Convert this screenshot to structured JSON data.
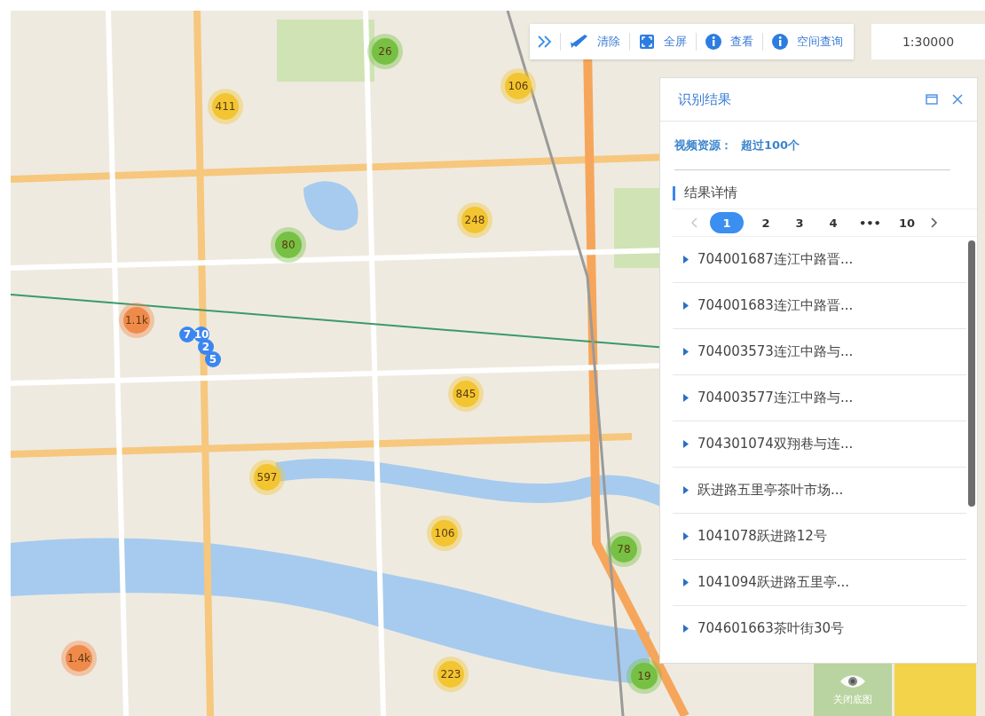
{
  "toolbar": {
    "items": [
      {
        "kind": "clear",
        "label": "清除"
      },
      {
        "kind": "fullscreen",
        "label": "全屏"
      },
      {
        "kind": "info",
        "label": "查看"
      },
      {
        "kind": "info",
        "label": "空间查询"
      }
    ],
    "scale": "1:30000"
  },
  "clusters": [
    {
      "label": "26",
      "color": "#76c043"
    },
    {
      "label": "106",
      "color": "#f2c531"
    },
    {
      "label": "411",
      "color": "#f2c531"
    },
    {
      "label": "248",
      "color": "#f2c531"
    },
    {
      "label": "80",
      "color": "#76c043"
    },
    {
      "label": "1.1k",
      "color": "#f08a4b"
    },
    {
      "label": "845",
      "color": "#f2c531"
    },
    {
      "label": "597",
      "color": "#f2c531"
    },
    {
      "label": "106",
      "color": "#f2c531"
    },
    {
      "label": "78",
      "color": "#76c043"
    },
    {
      "label": "1.4k",
      "color": "#f08a4b"
    },
    {
      "label": "223",
      "color": "#f2c531"
    },
    {
      "label": "19",
      "color": "#76c043"
    }
  ],
  "pins": [
    {
      "label": "7"
    },
    {
      "label": "10"
    },
    {
      "label": "2"
    },
    {
      "label": "5"
    }
  ],
  "panel": {
    "title": "识别结果",
    "resource_label": "视频资源：",
    "resource_value": "超过100个",
    "section_title": "结果详情",
    "pages": [
      {
        "label": "1",
        "selected": true
      },
      {
        "label": "2",
        "selected": false
      },
      {
        "label": "3",
        "selected": false
      },
      {
        "label": "4",
        "selected": false
      },
      {
        "label": "•••",
        "selected": false
      },
      {
        "label": "10",
        "selected": false
      }
    ],
    "results": [
      {
        "label": "704001687连江中路晋..."
      },
      {
        "label": "704001683连江中路晋..."
      },
      {
        "label": "704003573连江中路与..."
      },
      {
        "label": "704003577连江中路与..."
      },
      {
        "label": "704301074双翔巷与连..."
      },
      {
        "label": "跃进路五里亭茶叶市场..."
      },
      {
        "label": "1041078跃进路12号"
      },
      {
        "label": "1041094跃进路五里亭..."
      },
      {
        "label": "704601663茶叶街30号"
      }
    ]
  },
  "basemaps": [
    {
      "label": "关闭底图"
    }
  ]
}
